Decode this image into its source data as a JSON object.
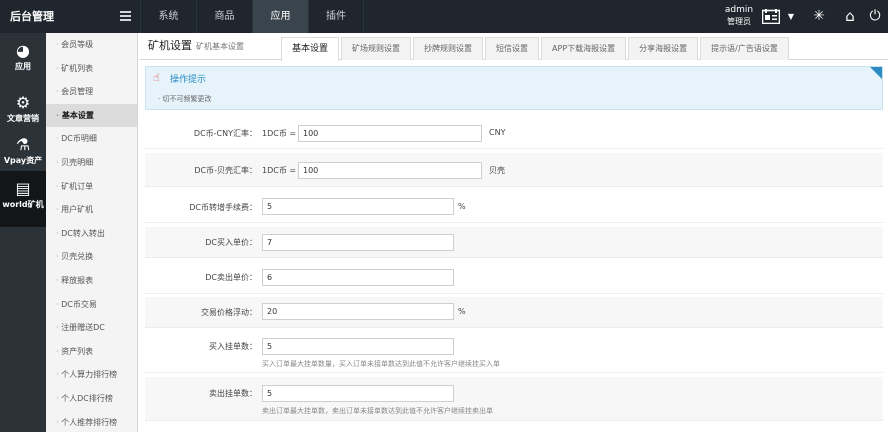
{
  "header": {
    "brand": "后台管理",
    "nav": [
      "系统",
      "商品",
      "应用",
      "插件"
    ],
    "user_name": "admin",
    "user_role": "管理员",
    "icons": [
      "menu-toggle-icon",
      "id-card-icon",
      "caret-down-icon",
      "loader-icon",
      "home-icon",
      "power-icon"
    ]
  },
  "iconbar": [
    {
      "label": "应用",
      "icon": "pie-chart-icon"
    },
    {
      "label": "文章营销",
      "icon": "gear-icon"
    },
    {
      "label": "Vpay资产",
      "icon": "flask-icon"
    },
    {
      "label": "world矿机",
      "icon": "document-icon"
    }
  ],
  "subnav": [
    "会员等级",
    "矿机列表",
    "会员管理",
    "基本设置",
    "DC币明细",
    "贝壳明细",
    "矿机订单",
    "用户矿机",
    "DC转入转出",
    "贝壳兑换",
    "释放报表",
    "DC币交易",
    "注册赠送DC",
    "资产列表",
    "个人算力排行榜",
    "个人DC排行榜",
    "个人推荐排行榜"
  ],
  "main": {
    "title": "矿机设置",
    "subtitle": "矿机基本设置",
    "tabs": [
      "基本设置",
      "矿场规则设置",
      "抄牌规则设置",
      "短信设置",
      "APP下载海报设置",
      "分享海报设置",
      "提示语/广告语设置"
    ]
  },
  "tip": {
    "title": "操作提示",
    "text": "· 切不可频繁更改"
  },
  "form": [
    {
      "label": "DC币-CNY汇率：",
      "prefix": "1DC币 =",
      "value": "100",
      "unit": "CNY",
      "help": ""
    },
    {
      "label": "DC币-贝壳汇率：",
      "prefix": "1DC币 =",
      "value": "100",
      "unit": "贝壳",
      "help": ""
    },
    {
      "label": "DC币转增手续费：",
      "prefix": "",
      "value": "5",
      "unit": "%",
      "help": ""
    },
    {
      "label": "DC买入单价：",
      "prefix": "",
      "value": "7",
      "unit": "",
      "help": ""
    },
    {
      "label": "DC卖出单价：",
      "prefix": "",
      "value": "6",
      "unit": "",
      "help": ""
    },
    {
      "label": "交易价格浮动：",
      "prefix": "",
      "value": "20",
      "unit": "%",
      "help": ""
    },
    {
      "label": "买入挂单数：",
      "prefix": "",
      "value": "5",
      "unit": "",
      "help": "买入订单最大挂单数量，买入订单未接单数达到此值不允许客户继续挂买入单"
    },
    {
      "label": "卖出挂单数：",
      "prefix": "",
      "value": "5",
      "unit": "",
      "help": "卖出订单最大挂单数，卖出订单未接单数达到此值不允许客户继续挂卖出单"
    }
  ],
  "colors": {
    "topbar_bg": "#1f262d",
    "iconbar_bg": "#2b3338",
    "tip_bg": "#e6f3fa",
    "tip_accent": "#2b8cc4"
  }
}
